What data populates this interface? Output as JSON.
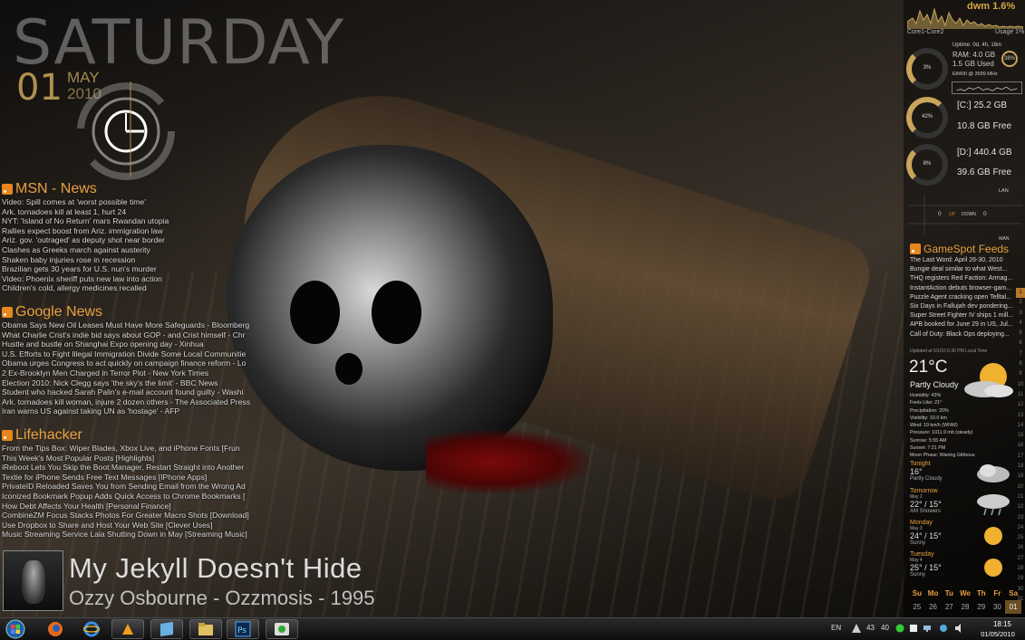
{
  "desktop": {
    "day": "SATURDAY",
    "date_num": "01",
    "month": "MAY",
    "year": "2010"
  },
  "feeds": [
    {
      "title": "MSN - News",
      "items": [
        "Video: Spill comes at 'worst possible time'",
        "Ark. tornadoes kill at least 1, hurt 24",
        "NYT: 'Island of No Return' mars Rwandan utopia",
        "Rallies expect boost from Ariz. immigration law",
        "Ariz. gov. 'outraged' as deputy shot near border",
        "Clashes as Greeks march against austerity",
        "Shaken baby injuries rose in recession",
        "Brazilian gets 30 years for U.S. nun's murder",
        "Video: Phoenix sheriff puts new law into action",
        "Children's cold, allergy medicines recalled"
      ]
    },
    {
      "title": "Google News",
      "items": [
        "Obama Says New Oil Leases Must Have More Safeguards - Bloomberg",
        "What Charlie Crist's indie bid says about GOP - and Crist himself - Chr",
        "Hustle and bustle on Shanghai Expo opening day - Xinhua",
        "U.S. Efforts to Fight Illegal Immigration Divide Some Local Communitie",
        "Obama urges Congress to act quickly on campaign finance reform - Lo",
        "2 Ex-Brooklyn Men Charged in Terror Plot - New York Times",
        "Election 2010: Nick Clegg says 'the sky's the limit' - BBC News",
        "Student who hacked Sarah Palin's e-mail account found guilty - Washi",
        "Ark. tornadoes kill woman, injure 2 dozen others - The Associated Press",
        "Iran warns US against taking UN as 'hostage' - AFP"
      ]
    },
    {
      "title": "Lifehacker",
      "items": [
        "From the Tips Box: Wiper Blades, Xbox Live, and iPhone Fonts [Frun",
        "This Week's Most Popular Posts [Highlights]",
        "iReboot Lets You Skip the Boot Manager, Restart Straight into Another",
        "Textie for iPhone Sends Free Text Messages [IPhone Apps]",
        "PrivateID Reloaded Saves You from Sending Email from the Wrong Ad",
        "Iconized Bookmark Popup Adds Quick Access to Chrome Bookmarks [",
        "How Debt Affects Your Health [Personal Finance]",
        "CombineZM Focus Stacks Photos For Greater Macro Shots [Download]",
        "Use Dropbox to Share and Host Your Web Site [Clever Uses]",
        "Music Streaming Service Lala Shutting Down in May [Streaming Music]"
      ]
    }
  ],
  "music": {
    "song": "My Jekyll Doesn't Hide",
    "artist_line": "Ozzy Osbourne - Ozzmosis - 1995"
  },
  "system": {
    "dwm": "dwm 1.6%",
    "core_label": "Core1-Core2",
    "usage": "Usage 1%",
    "cpu_pct": "3%",
    "uptime": "Uptime:  0d, 4h, 16m",
    "ram_total": "RAM: 4.0 GB",
    "ram_used": "1.5 GB Used",
    "ram_pct": "38%",
    "cpu_model": "E8400 @ 3599 MHz",
    "drive_c_pct": "42%",
    "drive_c_total": "[C:] 25.2 GB",
    "drive_c_free": "10.8 GB Free",
    "drive_d_pct": "8%",
    "drive_d_total": "[D:] 440.4 GB",
    "drive_d_free": "39.6 GB Free",
    "lan": "LAN",
    "up_val": "0",
    "up_label": "UP",
    "down_label": "DOWN",
    "down_val": "0",
    "wan": "WAN"
  },
  "gamespot": {
    "title": "GameSpot Feeds",
    "items": [
      "The Last Word: April 26-30, 2010",
      "Bungie deal similar to what West...",
      "THQ registers Red Faction: Armag...",
      "InstantAction debuts browser-gam...",
      "Puzzle Agent cracking open Telltal...",
      "Six Days in Fallujah dev pondering...",
      "Super Street Fighter IV ships 1 mill...",
      "APB booked for June 29 in US, Jul...",
      "Call of Duty: Black Ops deploying..."
    ]
  },
  "weather": {
    "updated": "Updated at 5/1/10 6:30 PM Local Time",
    "temp": "21°C",
    "condition": "Partly Cloudy",
    "details": [
      "Humidity: 43%",
      "Feels Like: 21°",
      "Precipitation: 20%",
      "Visibility: 10.0 km",
      "Wind: 19 km/h (WNW)",
      "Pressure: 1011.9 mb (steady)",
      "Sunrise: 5:55 AM",
      "Sunset: 7:21 PM",
      "Moon Phase: Waning Gibbous"
    ],
    "forecast": [
      {
        "day": "Tonight",
        "sub": "",
        "temp": "16°",
        "cond": "Partly Cloudy",
        "icon": "cloud-moon-icon"
      },
      {
        "day": "Tomorrow",
        "sub": "May 2",
        "temp": "22° / 15°",
        "cond": "AM Showers",
        "icon": "rain-cloud-icon"
      },
      {
        "day": "Monday",
        "sub": "May 3",
        "temp": "24° / 15°",
        "cond": "Sunny",
        "icon": "sun-icon"
      },
      {
        "day": "Tuesday",
        "sub": "May 4",
        "temp": "25° / 15°",
        "cond": "Sunny",
        "icon": "sun-icon"
      }
    ]
  },
  "sidebar_numbers": [
    "1",
    "2",
    "3",
    "4",
    "5",
    "6",
    "7",
    "8",
    "9",
    "10",
    "11",
    "12",
    "13",
    "14",
    "15",
    "16",
    "17",
    "18",
    "19",
    "20",
    "21",
    "22",
    "23",
    "24",
    "25",
    "26",
    "27",
    "28",
    "29",
    "30",
    "31"
  ],
  "calendar": {
    "headers": [
      "Su",
      "Mo",
      "Tu",
      "We",
      "Th",
      "Fr",
      "Sa"
    ],
    "days": [
      "25",
      "26",
      "27",
      "28",
      "29",
      "30",
      "01"
    ]
  },
  "taskbar": {
    "pinned": [
      "firefox-icon",
      "ie-icon",
      "winamp-icon",
      "window-icon",
      "folder-icon",
      "photoshop-icon",
      "media-icon"
    ],
    "lang": "EN",
    "tray_a": "43",
    "tray_b": "40",
    "time": "18:15",
    "date": "01/05/2010"
  },
  "colors": {
    "accent": "#e8a040",
    "gold": "#b09050"
  }
}
